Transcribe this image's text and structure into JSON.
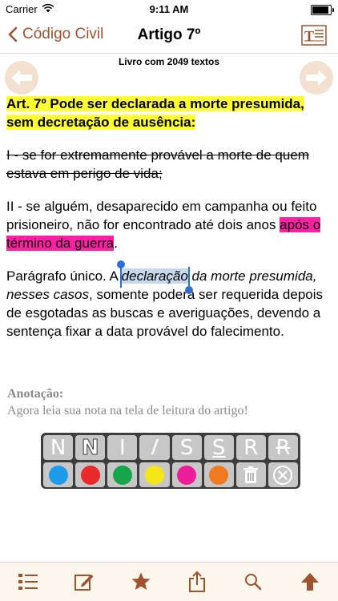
{
  "status": {
    "carrier": "Carrier",
    "time": "9:11 AM",
    "battery_level": 1.0
  },
  "nav": {
    "back_label": "Código Civil",
    "title": "Artigo 7º",
    "format_icon": "text-format-icon"
  },
  "book_count": "Livro com 2049 textos",
  "article": {
    "heading": "Art. 7º Pode ser declarada a morte presumida, sem decretação de ausência:",
    "item1": "I - se for extremamente provável a morte de quem estava em perigo de vida;",
    "item2_plain": "II - se alguém, desaparecido em campanha ou feito prisioneiro, não for encontrado até dois anos ",
    "item2_highlight": "após o término da guerra",
    "item2_end": ".",
    "para_start": "Parágrafo único. A ",
    "para_selected": "declaração",
    "para_italic": " da morte presumida, nesses casos",
    "para_end": ", somente poderá ser requerida depois de esgotadas as buscas e averiguações, devendo a sentença fixar a data provável do falecimento."
  },
  "annotation": {
    "label": "Anotação:",
    "text": "Agora leia sua nota na tela de leitura do artigo!"
  },
  "toolbar": {
    "normal": "N",
    "bold": "N",
    "italic_off": "I",
    "italic_on": "I",
    "underline_off": "S",
    "underline_on": "S",
    "strike_off": "R",
    "strike_on": "R",
    "colors": [
      "#1e9be8",
      "#e82a2a",
      "#16a54a",
      "#f5e61a",
      "#ee1e9a",
      "#f07a22"
    ]
  },
  "tabs": [
    "list-icon",
    "edit-note-icon",
    "star-icon",
    "share-icon",
    "search-icon",
    "up-arrow-icon"
  ],
  "accent": "#a0522d"
}
